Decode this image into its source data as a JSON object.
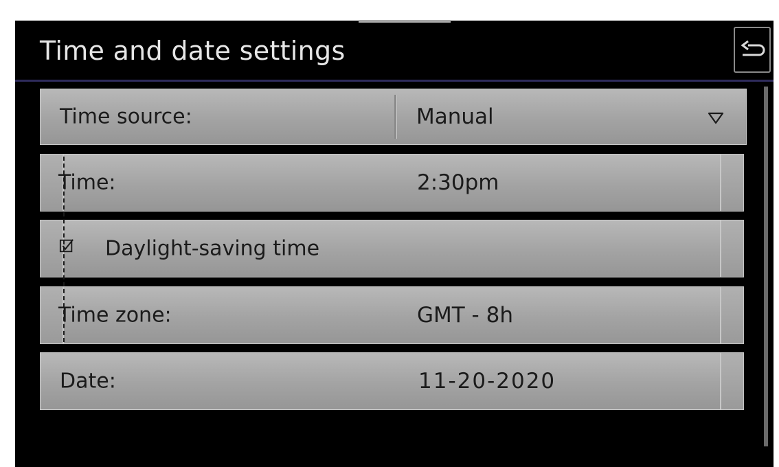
{
  "header": {
    "title": "Time and date settings",
    "back_icon": "back-return-icon"
  },
  "rows": {
    "time_source": {
      "label": "Time source:",
      "value": "Manual",
      "dropdown_icon": "triangle-down-icon"
    },
    "time": {
      "label": "Time:",
      "value": "2:30pm"
    },
    "daylight_saving": {
      "label": "Daylight-saving time",
      "checked": true,
      "check_icon": "checkbox-checked-icon"
    },
    "time_zone": {
      "label": "Time zone:",
      "value": "GMT - 8h"
    },
    "date": {
      "label": "Date:",
      "value": "11-20-2020"
    }
  },
  "colors": {
    "screen_background": "#000000",
    "header_accent": "#2f2c5c",
    "row_gray": "#a8a8a8",
    "title_text": "#e6e6e6",
    "row_text": "#1b1b1b"
  }
}
